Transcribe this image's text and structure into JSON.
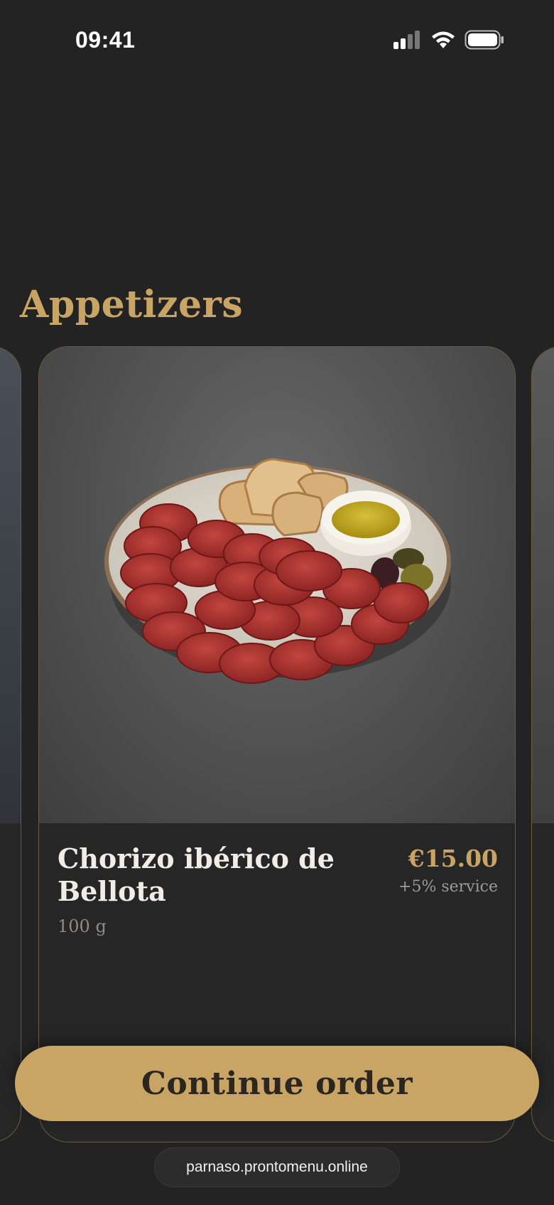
{
  "status_bar": {
    "time": "09:41",
    "icons": [
      "signal-icon",
      "wifi-icon",
      "battery-icon"
    ]
  },
  "section": {
    "title": "Appetizers"
  },
  "item": {
    "name": "Chorizo ibérico de Bellota",
    "price": "€15.00",
    "service_note": "+5% service",
    "weight": "100 g"
  },
  "actions": {
    "continue_label": "Continue order"
  },
  "browser": {
    "url": "parnaso.prontomenu.online"
  },
  "colors": {
    "background": "#232323",
    "accent_gold": "#c8a465",
    "button_gold": "#c9a565",
    "text_light": "#f1ede6"
  }
}
